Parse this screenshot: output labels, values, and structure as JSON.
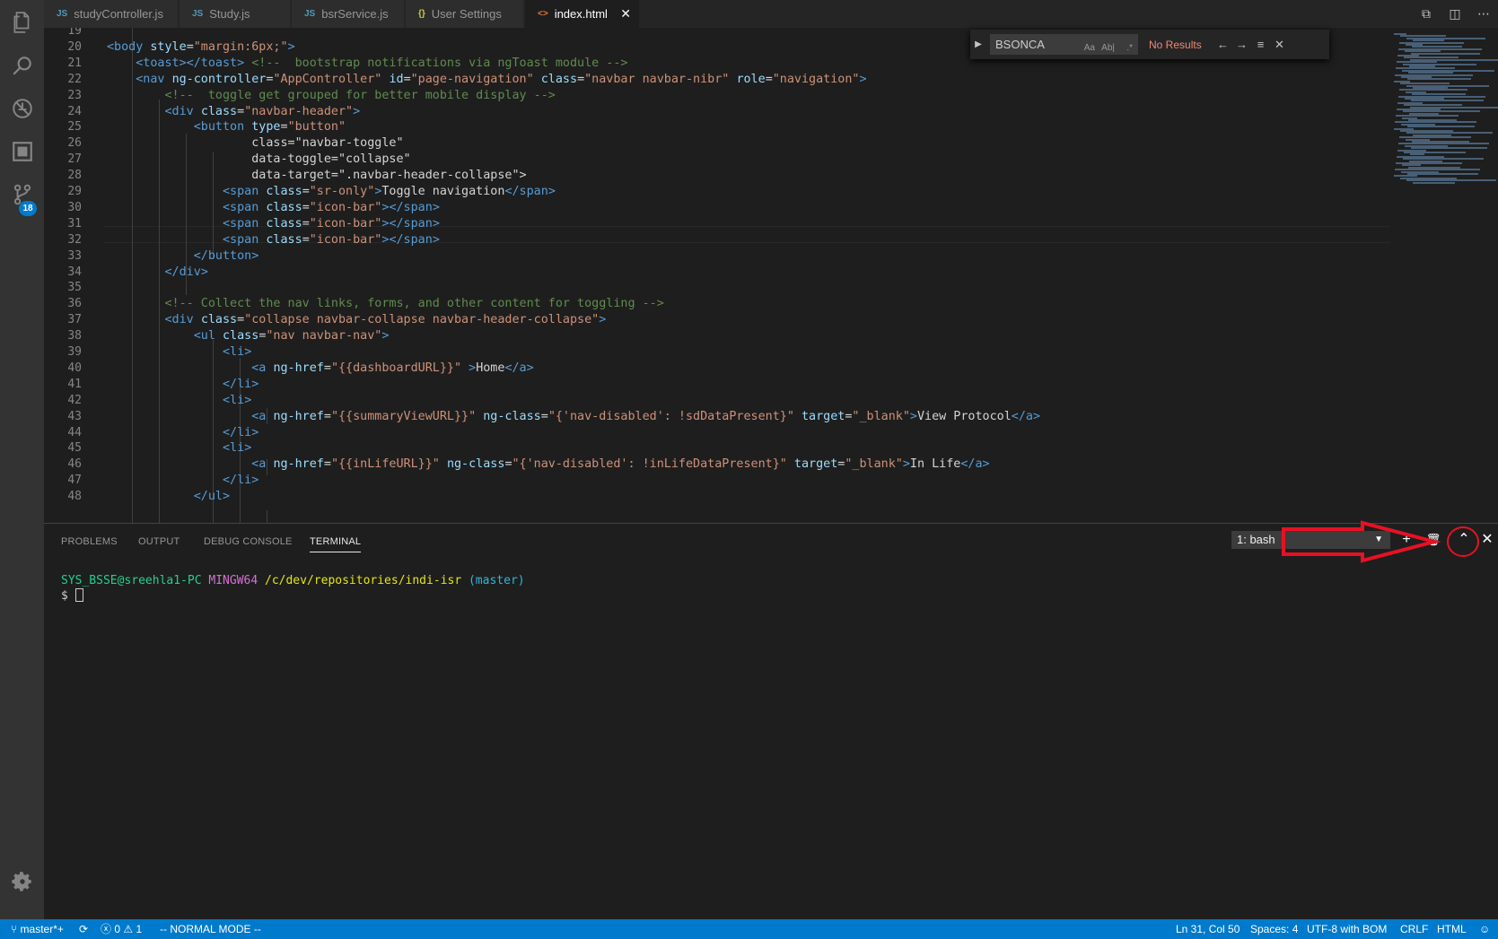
{
  "tabs": [
    {
      "icon": "JS",
      "label": "studyController.js",
      "active": false
    },
    {
      "icon": "JS",
      "label": "Study.js",
      "active": false
    },
    {
      "icon": "JS",
      "label": "bsrService.js",
      "active": false
    },
    {
      "icon": "{}",
      "label": "User Settings",
      "active": false
    },
    {
      "icon": "<>",
      "label": "index.html",
      "active": true
    }
  ],
  "activity": {
    "badge": "18"
  },
  "find": {
    "value": "BSONCA",
    "match_case": "Aa",
    "whole_word": "Ab|",
    "regex": ".*",
    "result": "No Results"
  },
  "editor": {
    "lines": [
      {
        "n": "19",
        "code": ""
      },
      {
        "n": "20",
        "code": "<body style=\"margin:6px;\">"
      },
      {
        "n": "21",
        "code": "    <toast></toast> <!--  bootstrap notifications via ngToast module -->"
      },
      {
        "n": "22",
        "code": "    <nav ng-controller=\"AppController\" id=\"page-navigation\" class=\"navbar navbar-nibr\" role=\"navigation\">"
      },
      {
        "n": "23",
        "code": "        <!--  toggle get grouped for better mobile display -->"
      },
      {
        "n": "24",
        "code": "        <div class=\"navbar-header\">"
      },
      {
        "n": "25",
        "code": "            <button type=\"button\""
      },
      {
        "n": "26",
        "code": "                    class=\"navbar-toggle\""
      },
      {
        "n": "27",
        "code": "                    data-toggle=\"collapse\""
      },
      {
        "n": "28",
        "code": "                    data-target=\".navbar-header-collapse\">"
      },
      {
        "n": "29",
        "code": "                <span class=\"sr-only\">Toggle navigation</span>"
      },
      {
        "n": "30",
        "code": "                <span class=\"icon-bar\"></span>"
      },
      {
        "n": "31",
        "code": "                <span class=\"icon-bar\"></span>"
      },
      {
        "n": "32",
        "code": "                <span class=\"icon-bar\"></span>"
      },
      {
        "n": "33",
        "code": "            </button>"
      },
      {
        "n": "34",
        "code": "        </div>"
      },
      {
        "n": "35",
        "code": ""
      },
      {
        "n": "36",
        "code": "        <!-- Collect the nav links, forms, and other content for toggling -->"
      },
      {
        "n": "37",
        "code": "        <div class=\"collapse navbar-collapse navbar-header-collapse\">"
      },
      {
        "n": "38",
        "code": "            <ul class=\"nav navbar-nav\">"
      },
      {
        "n": "39",
        "code": "                <li>"
      },
      {
        "n": "40",
        "code": "                    <a ng-href=\"{{dashboardURL}}\" >Home</a>"
      },
      {
        "n": "41",
        "code": "                </li>"
      },
      {
        "n": "42",
        "code": "                <li>"
      },
      {
        "n": "43",
        "code": "                    <a ng-href=\"{{summaryViewURL}}\" ng-class=\"{'nav-disabled': !sdDataPresent}\" target=\"_blank\">View Protocol</a>"
      },
      {
        "n": "44",
        "code": "                </li>"
      },
      {
        "n": "45",
        "code": "                <li>"
      },
      {
        "n": "46",
        "code": "                    <a ng-href=\"{{inLifeURL}}\" ng-class=\"{'nav-disabled': !inLifeDataPresent}\" target=\"_blank\">In Life</a>"
      },
      {
        "n": "47",
        "code": "                </li>"
      },
      {
        "n": "48",
        "code": "            </ul>"
      }
    ]
  },
  "panel": {
    "tabs": [
      "PROBLEMS",
      "OUTPUT",
      "DEBUG CONSOLE",
      "TERMINAL"
    ],
    "terminal_select": "1: bash",
    "terminal": {
      "user": "SYS_BSSE@sreehla1-PC",
      "env": "MINGW64",
      "path": "/c/dev/repositories/indi-isr",
      "branch": "(master)",
      "prompt": "$"
    }
  },
  "status": {
    "branch": "master*+",
    "errors": "0",
    "warnings": "1",
    "mode": "-- NORMAL MODE --",
    "position": "Ln 31, Col 50",
    "spaces": "Spaces: 4",
    "encoding": "UTF-8 with BOM",
    "eol": "CRLF",
    "language": "HTML"
  },
  "colors": {
    "accent": "#007acc",
    "annotation": "#e81123"
  }
}
